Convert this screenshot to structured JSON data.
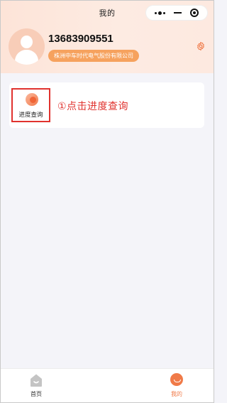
{
  "window": {
    "title": "我的"
  },
  "profile": {
    "phone": "13683909551",
    "company": "株洲中车时代电气股份有限公司"
  },
  "menu": {
    "items": [
      {
        "label": "进度查询",
        "icon": "progress-query-icon"
      }
    ]
  },
  "annotation": {
    "text": "①点击进度查询"
  },
  "tabbar": {
    "items": [
      {
        "label": "首页",
        "icon": "home-icon",
        "active": false
      },
      {
        "label": "我的",
        "icon": "profile-icon",
        "active": true
      }
    ]
  },
  "colors": {
    "accent": "#f07a48",
    "badge": "#f6a25e",
    "annotation": "#e0322e",
    "header_bg": "#fde4d8"
  }
}
